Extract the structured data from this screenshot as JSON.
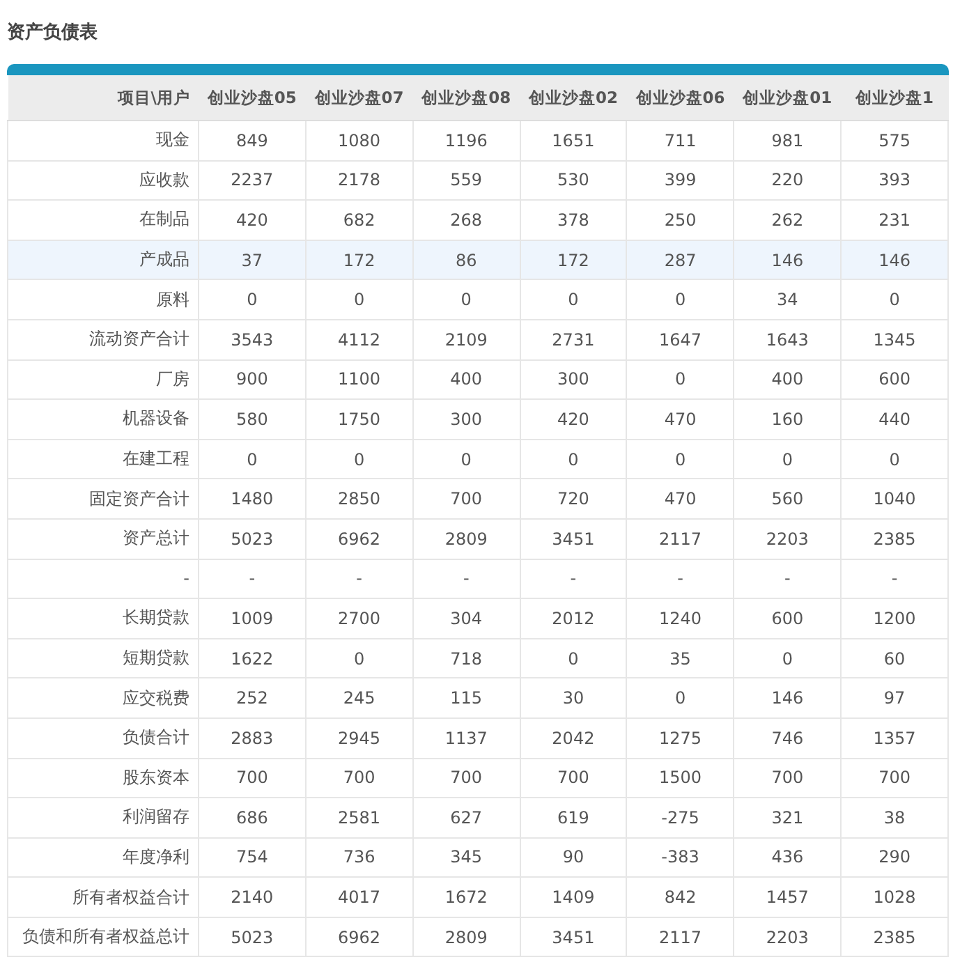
{
  "title": "资产负债表",
  "table": {
    "columns": [
      "项目\\用户",
      "创业沙盘05",
      "创业沙盘07",
      "创业沙盘08",
      "创业沙盘02",
      "创业沙盘06",
      "创业沙盘01",
      "创业沙盘1"
    ],
    "rows": [
      {
        "cells": [
          "现金",
          "849",
          "1080",
          "1196",
          "1651",
          "711",
          "981",
          "575"
        ],
        "selected": false
      },
      {
        "cells": [
          "应收款",
          "2237",
          "2178",
          "559",
          "530",
          "399",
          "220",
          "393"
        ],
        "selected": false
      },
      {
        "cells": [
          "在制品",
          "420",
          "682",
          "268",
          "378",
          "250",
          "262",
          "231"
        ],
        "selected": false
      },
      {
        "cells": [
          "产成品",
          "37",
          "172",
          "86",
          "172",
          "287",
          "146",
          "146"
        ],
        "selected": true
      },
      {
        "cells": [
          "原料",
          "0",
          "0",
          "0",
          "0",
          "0",
          "34",
          "0"
        ],
        "selected": false
      },
      {
        "cells": [
          "流动资产合计",
          "3543",
          "4112",
          "2109",
          "2731",
          "1647",
          "1643",
          "1345"
        ],
        "selected": false
      },
      {
        "cells": [
          "厂房",
          "900",
          "1100",
          "400",
          "300",
          "0",
          "400",
          "600"
        ],
        "selected": false
      },
      {
        "cells": [
          "机器设备",
          "580",
          "1750",
          "300",
          "420",
          "470",
          "160",
          "440"
        ],
        "selected": false
      },
      {
        "cells": [
          "在建工程",
          "0",
          "0",
          "0",
          "0",
          "0",
          "0",
          "0"
        ],
        "selected": false
      },
      {
        "cells": [
          "固定资产合计",
          "1480",
          "2850",
          "700",
          "720",
          "470",
          "560",
          "1040"
        ],
        "selected": false
      },
      {
        "cells": [
          "资产总计",
          "5023",
          "6962",
          "2809",
          "3451",
          "2117",
          "2203",
          "2385"
        ],
        "selected": false
      },
      {
        "cells": [
          "-",
          "-",
          "-",
          "-",
          "-",
          "-",
          "-",
          "-"
        ],
        "selected": false
      },
      {
        "cells": [
          "长期贷款",
          "1009",
          "2700",
          "304",
          "2012",
          "1240",
          "600",
          "1200"
        ],
        "selected": false
      },
      {
        "cells": [
          "短期贷款",
          "1622",
          "0",
          "718",
          "0",
          "35",
          "0",
          "60"
        ],
        "selected": false
      },
      {
        "cells": [
          "应交税费",
          "252",
          "245",
          "115",
          "30",
          "0",
          "146",
          "97"
        ],
        "selected": false
      },
      {
        "cells": [
          "负债合计",
          "2883",
          "2945",
          "1137",
          "2042",
          "1275",
          "746",
          "1357"
        ],
        "selected": false
      },
      {
        "cells": [
          "股东资本",
          "700",
          "700",
          "700",
          "700",
          "1500",
          "700",
          "700"
        ],
        "selected": false
      },
      {
        "cells": [
          "利润留存",
          "686",
          "2581",
          "627",
          "619",
          "-275",
          "321",
          "38"
        ],
        "selected": false
      },
      {
        "cells": [
          "年度净利",
          "754",
          "736",
          "345",
          "90",
          "-383",
          "436",
          "290"
        ],
        "selected": false
      },
      {
        "cells": [
          "所有者权益合计",
          "2140",
          "4017",
          "1672",
          "1409",
          "842",
          "1457",
          "1028"
        ],
        "selected": false
      },
      {
        "cells": [
          "负债和所有者权益总计",
          "5023",
          "6962",
          "2809",
          "3451",
          "2117",
          "2203",
          "2385"
        ],
        "selected": false
      }
    ]
  }
}
